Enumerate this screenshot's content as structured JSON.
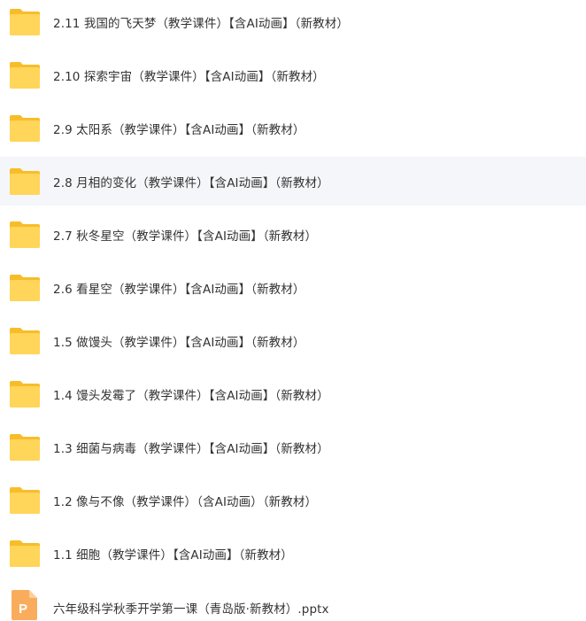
{
  "colors": {
    "folder_back": "#f7bd29",
    "folder_front": "#ffd55a",
    "pptx_icon": "#f9ad5c",
    "hover_row_bg": "#f5f6f9",
    "text": "#333333"
  },
  "items": [
    {
      "type": "folder",
      "icon": "folder-icon",
      "name": "2.11 我国的飞天梦（教学课件）【含AI动画】（新教材）"
    },
    {
      "type": "folder",
      "icon": "folder-icon",
      "name": "2.10 探索宇宙（教学课件）【含AI动画】（新教材）"
    },
    {
      "type": "folder",
      "icon": "folder-icon",
      "name": "2.9 太阳系（教学课件）【含AI动画】（新教材）"
    },
    {
      "type": "folder",
      "icon": "folder-icon",
      "name": "2.8 月相的变化（教学课件）【含AI动画】（新教材）",
      "highlighted": true
    },
    {
      "type": "folder",
      "icon": "folder-icon",
      "name": "2.7 秋冬星空（教学课件）【含AI动画】（新教材）"
    },
    {
      "type": "folder",
      "icon": "folder-icon",
      "name": "2.6 看星空（教学课件）【含AI动画】（新教材）"
    },
    {
      "type": "folder",
      "icon": "folder-icon",
      "name": "1.5 做馒头（教学课件）【含AI动画】（新教材）"
    },
    {
      "type": "folder",
      "icon": "folder-icon",
      "name": "1.4 馒头发霉了（教学课件）【含AI动画】（新教材）"
    },
    {
      "type": "folder",
      "icon": "folder-icon",
      "name": "1.3 细菌与病毒（教学课件）【含AI动画】（新教材）"
    },
    {
      "type": "folder",
      "icon": "folder-icon",
      "name": "1.2 像与不像（教学课件）（含AI动画）（新教材）"
    },
    {
      "type": "folder",
      "icon": "folder-icon",
      "name": "1.1 细胞（教学课件）【含AI动画】（新教材）"
    },
    {
      "type": "pptx",
      "icon": "pptx-file-icon",
      "icon_letter": "P",
      "name": "六年级科学秋季开学第一课（青岛版·新教材）.pptx"
    }
  ]
}
